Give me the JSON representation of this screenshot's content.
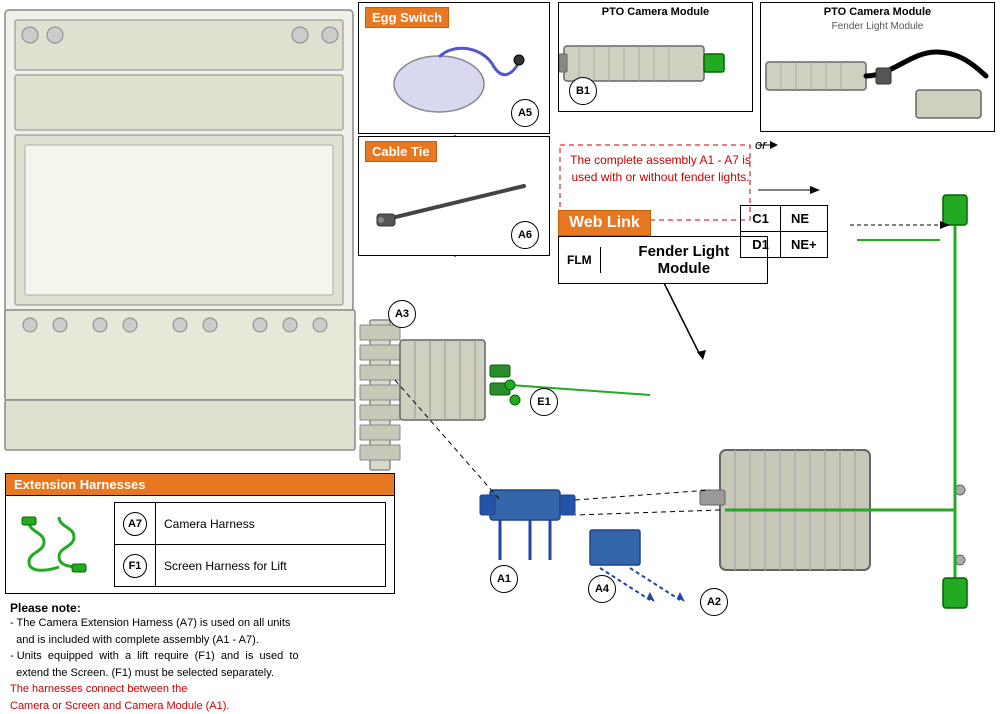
{
  "callouts": {
    "egg_switch": {
      "title": "Egg Switch",
      "label": "A5"
    },
    "cable_tie": {
      "title": "Cable Tie",
      "label": "A6"
    }
  },
  "pto_modules": {
    "left": {
      "title": "PTO Camera Module",
      "label": "B1"
    },
    "right": {
      "title": "PTO Camera Module",
      "subtitle": "Fender Light Module"
    }
  },
  "assembly_text": "The complete assembly A1 - A7 is used with or without fender lights.",
  "or_text": "or",
  "weblink": {
    "title": "Web Link",
    "flm_badge": "FLM",
    "flm_text": "Fender Light Module"
  },
  "ne_table": {
    "rows": [
      {
        "id": "C1",
        "label": "NE"
      },
      {
        "id": "D1",
        "label": "NE+"
      }
    ]
  },
  "ext_harnesses": {
    "title": "Extension Harnesses",
    "items": [
      {
        "id": "A7",
        "label": "Camera Harness"
      },
      {
        "id": "F1",
        "label": "Screen Harness for Lift"
      }
    ]
  },
  "labels": {
    "A1": "A1",
    "A2": "A2",
    "A3": "A3",
    "A4": "A4",
    "E1": "E1"
  },
  "notes": {
    "title": "Please note:",
    "lines": [
      "- The Camera Extension Harness (A7) is used on all units",
      "  and is included with complete assembly (A1 - A7).",
      "- Units  equipped  with  a  lift  require  (F1)  and  is  used  to",
      "  extend the Screen. (F1) must be selected separately."
    ],
    "red_lines": [
      "The harnesses connect between the",
      "Camera or Screen and Camera Module (A1)."
    ]
  }
}
